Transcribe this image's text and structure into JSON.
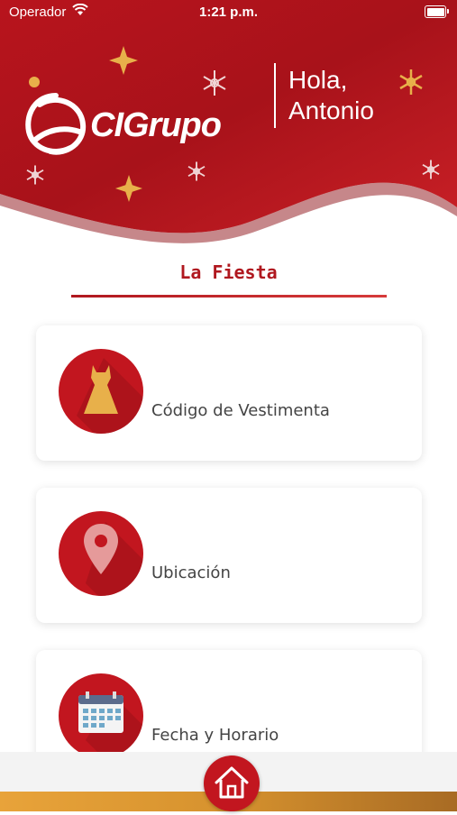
{
  "status_bar": {
    "carrier": "Operador",
    "time": "1:21 p.m."
  },
  "header": {
    "logo_text": "CIGrupo",
    "greeting_line1": "Hola,",
    "greeting_line2": "Antonio"
  },
  "section": {
    "title": "La Fiesta"
  },
  "cards": [
    {
      "label": "Código de Vestimenta",
      "icon": "dress-icon"
    },
    {
      "label": "Ubicación",
      "icon": "location-pin-icon"
    },
    {
      "label": "Fecha y Horario",
      "icon": "calendar-icon"
    }
  ],
  "bottom_nav": {
    "home_icon": "home-icon"
  },
  "colors": {
    "brand_red": "#c2161f",
    "dark_red": "#9e1219",
    "gold": "#e8b04a"
  }
}
